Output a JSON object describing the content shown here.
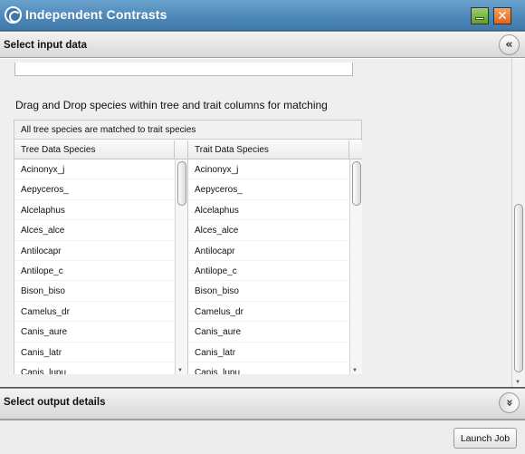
{
  "window": {
    "title": "Independent Contrasts"
  },
  "input_section": {
    "title": "Select input data",
    "toggle_glyph": "«"
  },
  "instruction": "Drag and Drop species within tree and trait columns for matching",
  "match_status": "All tree species are matched to trait species",
  "tree_column": {
    "header": "Tree Data Species",
    "rows": [
      "Acinonyx_j",
      "Aepyceros_",
      "Alcelaphus",
      "Alces_alce",
      "Antilocapr",
      "Antilope_c",
      "Bison_biso",
      "Camelus_dr",
      "Canis_aure",
      "Canis_latr",
      "Canis_lupu"
    ]
  },
  "trait_column": {
    "header": "Trait Data Species",
    "rows": [
      "Acinonyx_j",
      "Aepyceros_",
      "Alcelaphus",
      "Alces_alce",
      "Antilocapr",
      "Antilope_c",
      "Bison_biso",
      "Camelus_dr",
      "Canis_aure",
      "Canis_latr",
      "Canis_lupu"
    ]
  },
  "output_section": {
    "title": "Select output details",
    "toggle_glyph": "»"
  },
  "footer": {
    "launch_label": "Launch Job"
  },
  "icons": {
    "app": "app-logo-icon",
    "minimize": "minimize-icon",
    "close": "close-icon",
    "collapse": "collapse-up-icon",
    "expand": "expand-down-icon"
  },
  "colors": {
    "titlebar": "#4f89b9",
    "minimize": "#5aa02b",
    "close": "#e2641d"
  }
}
